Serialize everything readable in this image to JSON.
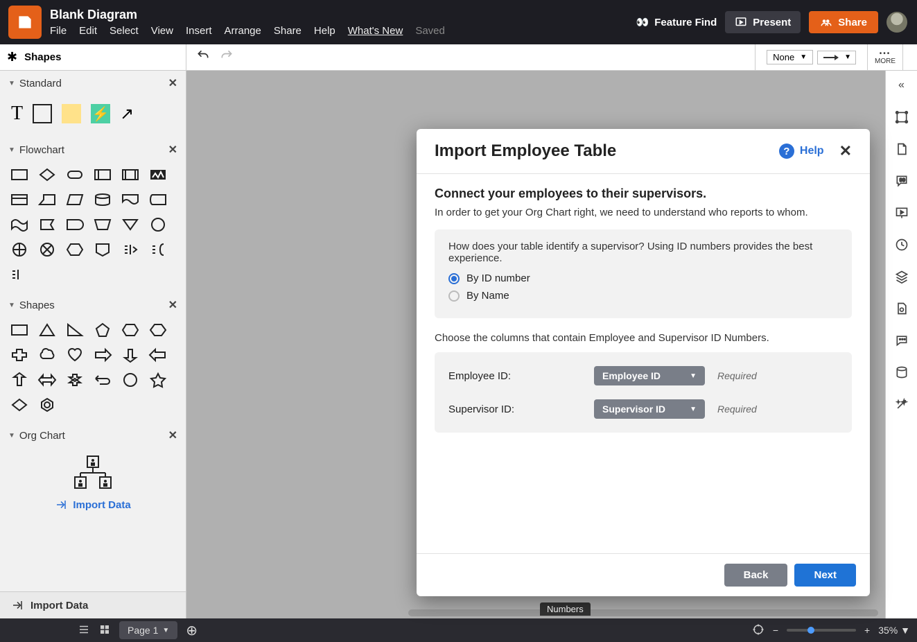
{
  "header": {
    "doc_title": "Blank Diagram",
    "menu": [
      "File",
      "Edit",
      "Select",
      "View",
      "Insert",
      "Arrange",
      "Share",
      "Help",
      "What's New"
    ],
    "saved": "Saved",
    "feature_find": "Feature Find",
    "present": "Present",
    "share": "Share"
  },
  "toolbar": {
    "shapes_label": "Shapes",
    "line_style": "None",
    "more": "MORE"
  },
  "left": {
    "sections": {
      "standard": "Standard",
      "flowchart": "Flowchart",
      "shapes": "Shapes",
      "orgchart": "Org Chart"
    },
    "import_data": "Import Data",
    "import_data_footer": "Import Data"
  },
  "modal": {
    "title": "Import Employee Table",
    "help": "Help",
    "subtitle": "Connect your employees to their supervisors.",
    "desc": "In order to get your Org Chart right, we need to understand who reports to whom.",
    "question": "How does your table identify a supervisor? Using ID numbers provides the best experience.",
    "opt_id": "By ID number",
    "opt_name": "By Name",
    "choose": "Choose the columns that contain Employee and Supervisor ID Numbers.",
    "emp_label": "Employee ID:",
    "emp_value": "Employee ID",
    "sup_label": "Supervisor ID:",
    "sup_value": "Supervisor ID",
    "required": "Required",
    "back": "Back",
    "next": "Next"
  },
  "bottom": {
    "page": "Page 1",
    "zoom": "35%",
    "tooltip": "Numbers"
  }
}
